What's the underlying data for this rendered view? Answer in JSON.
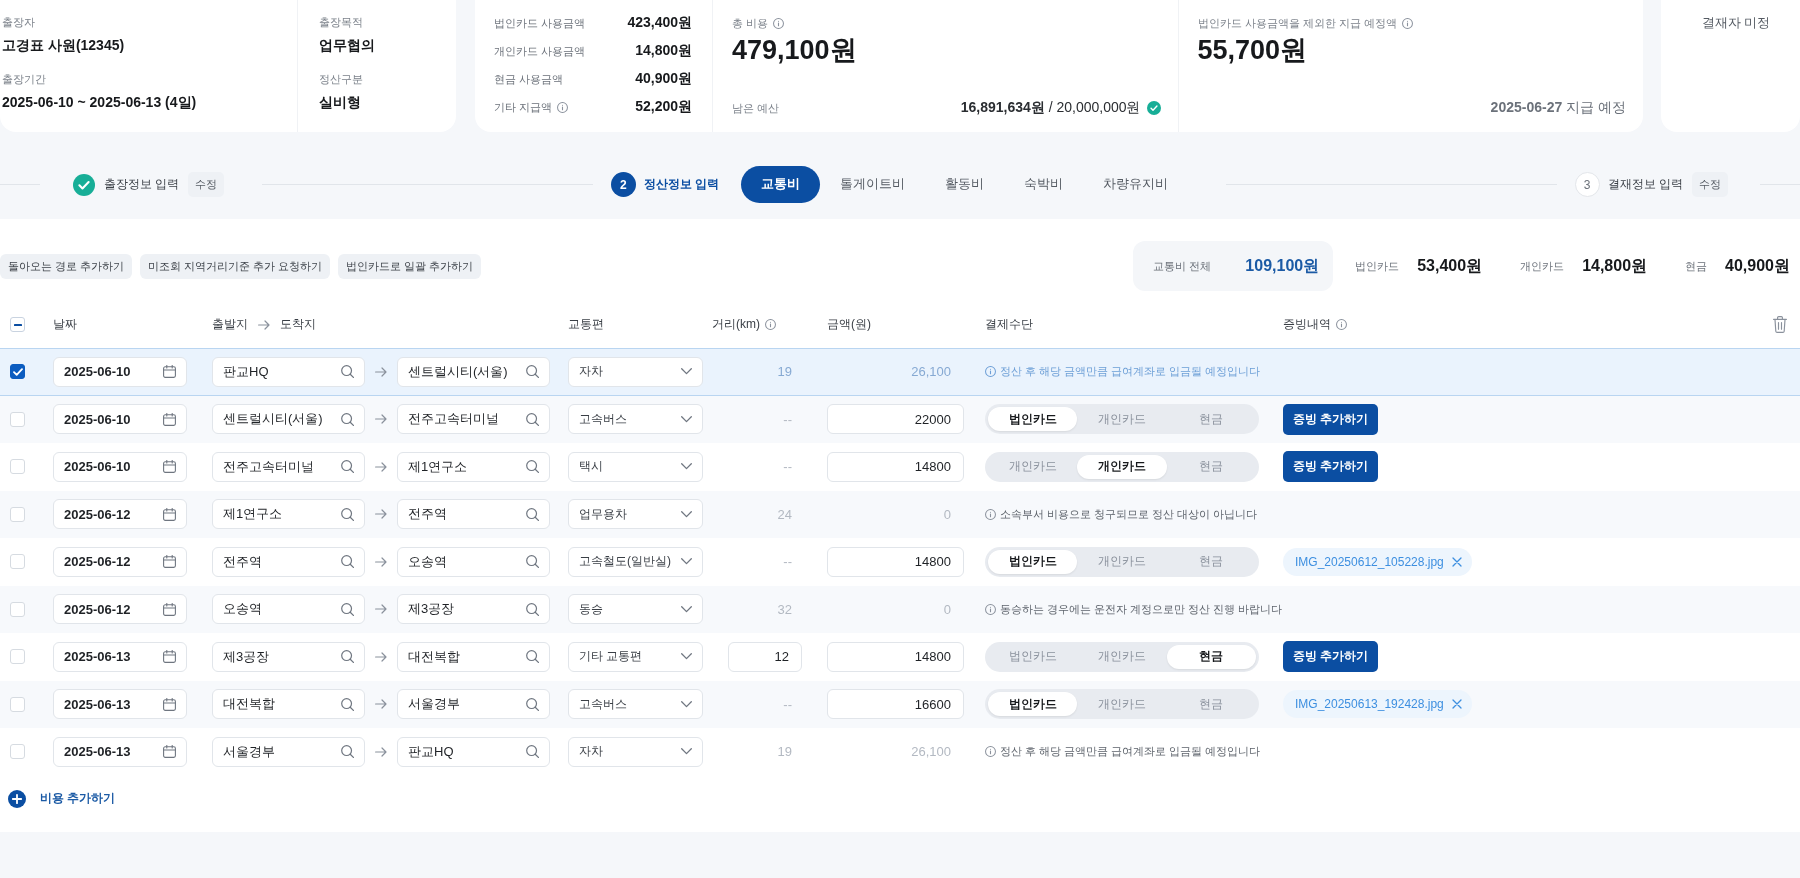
{
  "trip_info": {
    "columns": [
      {
        "fields": [
          {
            "label": "출장자",
            "value": "고경표 사원(12345)"
          },
          {
            "label": "출장기간",
            "value": "2025-06-10 ~ 2025-06-13 (4일)"
          }
        ]
      },
      {
        "fields": [
          {
            "label": "출장목적",
            "value": "업무협의"
          },
          {
            "label": "정산구분",
            "value": "실비형"
          }
        ]
      }
    ]
  },
  "usage": [
    {
      "label": "법인카드 사용금액",
      "info": false,
      "value": "423,400원"
    },
    {
      "label": "개인카드 사용금액",
      "info": false,
      "value": "14,800원"
    },
    {
      "label": "현금 사용금액",
      "info": false,
      "value": "40,900원"
    },
    {
      "label": "기타 지급액",
      "info": true,
      "value": "52,200원"
    }
  ],
  "total": {
    "label": "총 비용",
    "info": true,
    "amount": "479,100원",
    "budget_label": "남은 예산",
    "budget": "**16,891,634원** / 20,000,000원",
    "within_budget": true
  },
  "payout": {
    "label": "법인카드 사용금액을 제외한 지급 예정액",
    "info": true,
    "amount": "55,700원",
    "date": "**2025-06-27** 지급 예정"
  },
  "approver": {
    "label": "결재자 미정"
  },
  "steps": [
    {
      "kind": "done",
      "label": "출장정보 입력",
      "edit_label": "수정"
    },
    {
      "kind": "current",
      "number": "2",
      "label": "정산정보 입력",
      "tabs": [
        {
          "label": "교통비",
          "selected": true
        },
        {
          "label": "톨게이트비",
          "selected": false
        },
        {
          "label": "활동비",
          "selected": false
        },
        {
          "label": "숙박비",
          "selected": false
        },
        {
          "label": "차량유지비",
          "selected": false
        }
      ]
    },
    {
      "kind": "upcoming",
      "number": "3",
      "label": "결재정보 입력",
      "edit_label": "수정"
    }
  ],
  "actions": [
    "돌아오는 경로 추가하기",
    "미조회 지역거리기준 추가 요청하기",
    "법인카드로 일괄 추가하기"
  ],
  "summary": {
    "total_label": "교통비 전체",
    "total": "109,100원",
    "parts": [
      {
        "label": "법인카드",
        "value": "53,400원"
      },
      {
        "label": "개인카드",
        "value": "14,800원"
      },
      {
        "label": "현금",
        "value": "40,900원"
      }
    ]
  },
  "table": {
    "select_all": {
      "indeterminate": true
    },
    "columns": [
      {
        "kind": "text",
        "label": "날짜",
        "info": false
      },
      {
        "kind": "route",
        "from": "출발지",
        "to": "도착지"
      },
      {
        "kind": "text",
        "label": "교통편",
        "info": false
      },
      {
        "kind": "text",
        "label": "거리(km)",
        "info": true
      },
      {
        "kind": "text",
        "label": "금액(원)",
        "info": false
      },
      {
        "kind": "text",
        "label": "결제수단",
        "info": false
      },
      {
        "kind": "text",
        "label": "증빙내역",
        "info": true
      }
    ],
    "rows": [
      {
        "checked": true,
        "date": "2025-06-10",
        "from": "판교HQ",
        "to": "센트럴시티(서울)",
        "transport": "자차",
        "distance": {
          "kind": "text",
          "value": "19"
        },
        "amount": {
          "kind": "text",
          "value": "26,100"
        },
        "detail": {
          "kind": "note",
          "text": "정산 후 해당 금액만큼 급여계좌로 입금될 예정입니다"
        }
      },
      {
        "checked": false,
        "date": "2025-06-10",
        "from": "센트럴시티(서울)",
        "to": "전주고속터미널",
        "transport": "고속버스",
        "distance": {
          "kind": "text",
          "value": "--"
        },
        "amount": {
          "kind": "input",
          "value": "22000"
        },
        "detail": {
          "kind": "payment",
          "options": [
            {
              "label": "법인카드",
              "selected": true
            },
            {
              "label": "개인카드",
              "selected": false
            },
            {
              "label": "현금",
              "selected": false
            }
          ],
          "evidence": {
            "kind": "button",
            "label": "증빙 추가하기"
          }
        }
      },
      {
        "checked": false,
        "date": "2025-06-10",
        "from": "전주고속터미널",
        "to": "제1연구소",
        "transport": "택시",
        "distance": {
          "kind": "text",
          "value": "--"
        },
        "amount": {
          "kind": "input",
          "value": "14800"
        },
        "detail": {
          "kind": "payment",
          "options": [
            {
              "label": "개인카드",
              "selected": false
            },
            {
              "label": "개인카드",
              "selected": true
            },
            {
              "label": "현금",
              "selected": false
            }
          ],
          "evidence": {
            "kind": "button",
            "label": "증빙 추가하기"
          }
        }
      },
      {
        "checked": false,
        "date": "2025-06-12",
        "from": "제1연구소",
        "to": "전주역",
        "transport": "업무용차",
        "distance": {
          "kind": "text",
          "value": "24"
        },
        "amount": {
          "kind": "text",
          "value": "0"
        },
        "detail": {
          "kind": "note",
          "text": "소속부서 비용으로 청구되므로 정산 대상이 아닙니다"
        }
      },
      {
        "checked": false,
        "date": "2025-06-12",
        "from": "전주역",
        "to": "오송역",
        "transport": "고속철도(일반실)",
        "distance": {
          "kind": "text",
          "value": "--"
        },
        "amount": {
          "kind": "input",
          "value": "14800"
        },
        "detail": {
          "kind": "payment",
          "options": [
            {
              "label": "법인카드",
              "selected": true
            },
            {
              "label": "개인카드",
              "selected": false
            },
            {
              "label": "현금",
              "selected": false
            }
          ],
          "evidence": {
            "kind": "file",
            "name": "IMG_20250612_105228.jpg"
          }
        }
      },
      {
        "checked": false,
        "date": "2025-06-12",
        "from": "오송역",
        "to": "제3공장",
        "transport": "동승",
        "distance": {
          "kind": "text",
          "value": "32"
        },
        "amount": {
          "kind": "text",
          "value": "0"
        },
        "detail": {
          "kind": "note",
          "text": "동승하는 경우에는 운전자 계정으로만 정산 진행 바랍니다"
        }
      },
      {
        "checked": false,
        "date": "2025-06-13",
        "from": "제3공장",
        "to": "대전복합",
        "transport": "기타 교통편",
        "distance": {
          "kind": "input",
          "value": "12"
        },
        "amount": {
          "kind": "input",
          "value": "14800"
        },
        "detail": {
          "kind": "payment",
          "options": [
            {
              "label": "법인카드",
              "selected": false
            },
            {
              "label": "개인카드",
              "selected": false
            },
            {
              "label": "현금",
              "selected": true
            }
          ],
          "evidence": {
            "kind": "button",
            "label": "증빙 추가하기"
          }
        }
      },
      {
        "checked": false,
        "date": "2025-06-13",
        "from": "대전복합",
        "to": "서울경부",
        "transport": "고속버스",
        "distance": {
          "kind": "text",
          "value": "--"
        },
        "amount": {
          "kind": "input",
          "value": "16600"
        },
        "detail": {
          "kind": "payment",
          "options": [
            {
              "label": "법인카드",
              "selected": true
            },
            {
              "label": "개인카드",
              "selected": false
            },
            {
              "label": "현금",
              "selected": false
            }
          ],
          "evidence": {
            "kind": "file",
            "name": "IMG_20250613_192428.jpg"
          }
        }
      },
      {
        "checked": false,
        "date": "2025-06-13",
        "from": "서울경부",
        "to": "판교HQ",
        "transport": "자차",
        "distance": {
          "kind": "text",
          "value": "19"
        },
        "amount": {
          "kind": "text",
          "value": "26,100"
        },
        "detail": {
          "kind": "note",
          "text": "정산 후 해당 금액만큼 급여계좌로 입금될 예정입니다"
        }
      }
    ]
  },
  "add_row": {
    "label": "비용 추가하기"
  }
}
